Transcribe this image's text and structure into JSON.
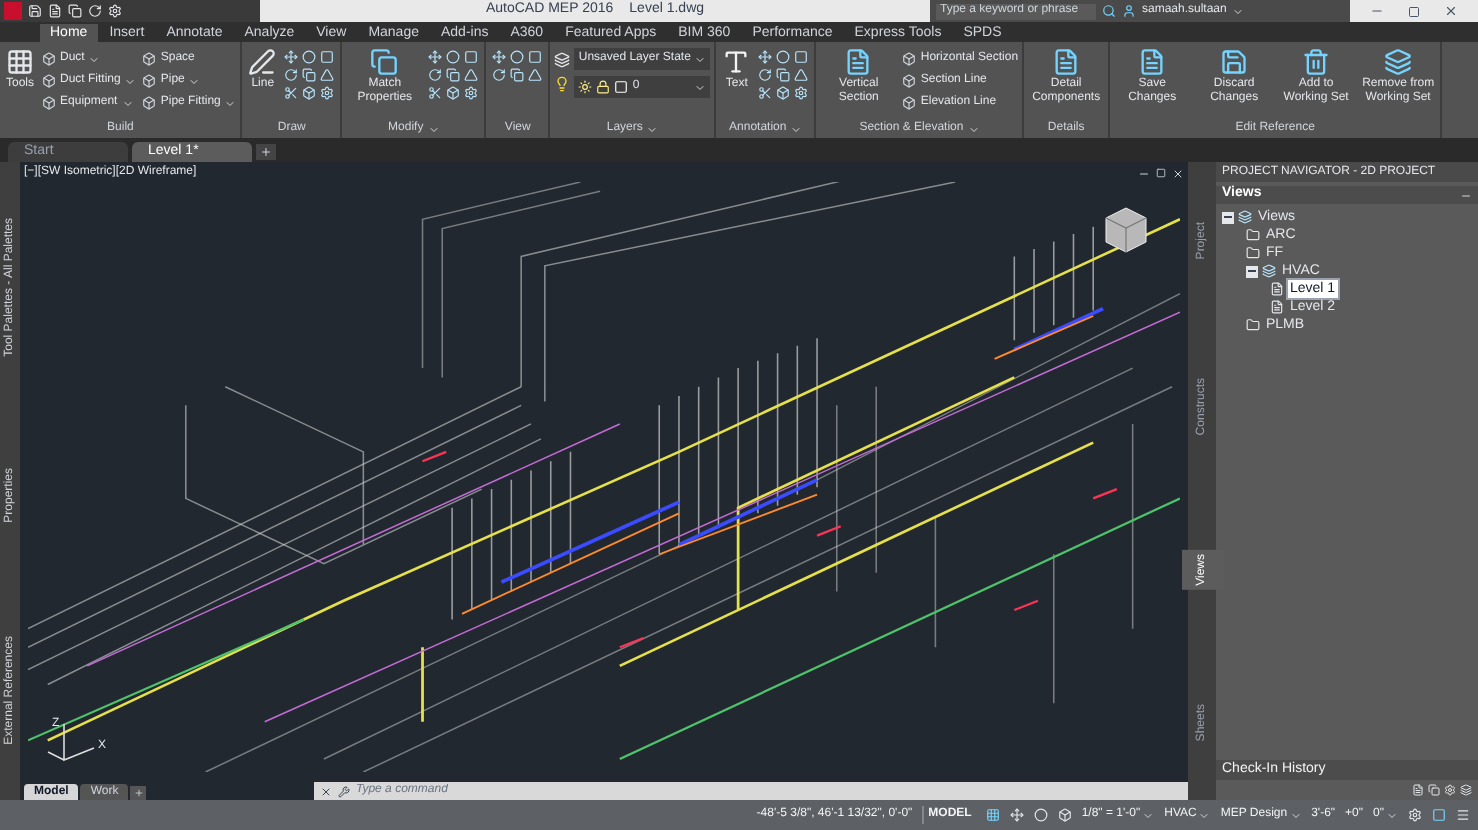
{
  "title_bar": {
    "title": "AutoCAD MEP 2016",
    "document": "Level 1.dwg",
    "search": {
      "placeholder": "Type a keyword or phrase"
    },
    "user": "samaah.sultaan"
  },
  "ribbon_tabs": [
    {
      "label": "Home",
      "selected": true
    },
    {
      "label": "Insert",
      "selected": false
    },
    {
      "label": "Annotate",
      "selected": false
    },
    {
      "label": "Analyze",
      "selected": false
    },
    {
      "label": "View",
      "selected": false
    },
    {
      "label": "Manage",
      "selected": false
    },
    {
      "label": "Add-ins",
      "selected": false
    },
    {
      "label": "A360",
      "selected": false
    },
    {
      "label": "Featured Apps",
      "selected": false
    },
    {
      "label": "BIM 360",
      "selected": false
    },
    {
      "label": "Performance",
      "selected": false
    },
    {
      "label": "Express Tools",
      "selected": false
    },
    {
      "label": "SPDS",
      "selected": false
    }
  ],
  "ribbon_panels": [
    {
      "kind": "buttons",
      "label": "Build",
      "menu": false,
      "large": [
        "Tools"
      ],
      "columns": [
        [
          {
            "label": "Duct",
            "menu": true
          },
          {
            "label": "Duct Fitting",
            "menu": true
          },
          {
            "label": "Equipment",
            "menu": true
          }
        ],
        [
          {
            "label": "Space",
            "menu": false
          },
          {
            "label": "Pipe",
            "menu": true
          },
          {
            "label": "Pipe Fitting",
            "menu": true
          }
        ]
      ]
    },
    {
      "kind": "icons",
      "label": "Draw",
      "menu": false,
      "large": [
        "Line"
      ]
    },
    {
      "kind": "icons",
      "label": "Modify",
      "menu": true,
      "large": [
        "Match Properties"
      ]
    },
    {
      "kind": "icons",
      "label": "View",
      "menu": false
    },
    {
      "kind": "layers",
      "label": "Layers",
      "menu": true,
      "fields": [
        "Unsaved Layer State",
        "0"
      ]
    },
    {
      "kind": "icons",
      "label": "Annotation",
      "menu": true,
      "large": [
        "Text"
      ]
    },
    {
      "kind": "buttons",
      "label": "Section & Elevation",
      "menu": true,
      "large": [
        "Vertical Section"
      ],
      "columns": [
        [
          {
            "label": "Horizontal Section",
            "menu": false
          },
          {
            "label": "Section Line",
            "menu": false
          },
          {
            "label": "Elevation Line",
            "menu": false
          }
        ]
      ]
    },
    {
      "kind": "buttons",
      "label": "Details",
      "menu": false,
      "large": [
        "Detail Components"
      ]
    },
    {
      "kind": "buttons",
      "label": "Edit Reference",
      "menu": false,
      "large": [
        "Save Changes",
        "Discard Changes",
        "Add to Working Set",
        "Remove from Working Set"
      ]
    }
  ],
  "file_tabs": [
    {
      "label": "Start",
      "selected": false
    },
    {
      "label": "Level 1*",
      "selected": true
    }
  ],
  "left_palettes": [
    "Tool Palettes - All Palettes",
    "Properties",
    "External References"
  ],
  "viewport": {
    "label": "[−][SW Isometric][2D Wireframe]",
    "ucs_labels": [
      "Z",
      "X"
    ]
  },
  "layout_tabs": [
    {
      "label": "Model",
      "selected": true
    },
    {
      "label": "Work",
      "selected": false
    }
  ],
  "command_line": {
    "placeholder": "Type a command"
  },
  "navigator": {
    "title": "PROJECT NAVIGATOR - 2D PROJECT",
    "tabs": [
      {
        "label": "Project",
        "selected": false
      },
      {
        "label": "Constructs",
        "selected": false
      },
      {
        "label": "Views",
        "selected": true
      },
      {
        "label": "Sheets",
        "selected": false
      }
    ],
    "section": "Views",
    "tree": [
      {
        "label": "Views",
        "kind": "category",
        "expanded": true,
        "selected": false,
        "children": [
          {
            "label": "ARC",
            "kind": "folder",
            "selected": false
          },
          {
            "label": "FF",
            "kind": "folder",
            "selected": false
          },
          {
            "label": "HVAC",
            "kind": "category",
            "expanded": true,
            "selected": false,
            "children": [
              {
                "label": "Level 1",
                "kind": "view",
                "selected": true
              },
              {
                "label": "Level 2",
                "kind": "view",
                "selected": false
              }
            ]
          },
          {
            "label": "PLMB",
            "kind": "folder",
            "selected": false
          }
        ]
      }
    ],
    "footer": "Check-In History"
  },
  "status_bar": {
    "coordinates": "-48'-5 3/8\", 46'-1 13/32\", 0'-0\"",
    "mode": "MODEL",
    "items": [
      {
        "label": "1/8\" = 1'-0\"",
        "menu": true
      },
      {
        "label": "HVAC",
        "menu": true
      },
      {
        "label": "MEP Design",
        "menu": true
      },
      {
        "label": "3'-6\"",
        "menu": false
      },
      {
        "label": "+0\"",
        "menu": false
      },
      {
        "label": "0\"",
        "menu": true
      }
    ]
  }
}
